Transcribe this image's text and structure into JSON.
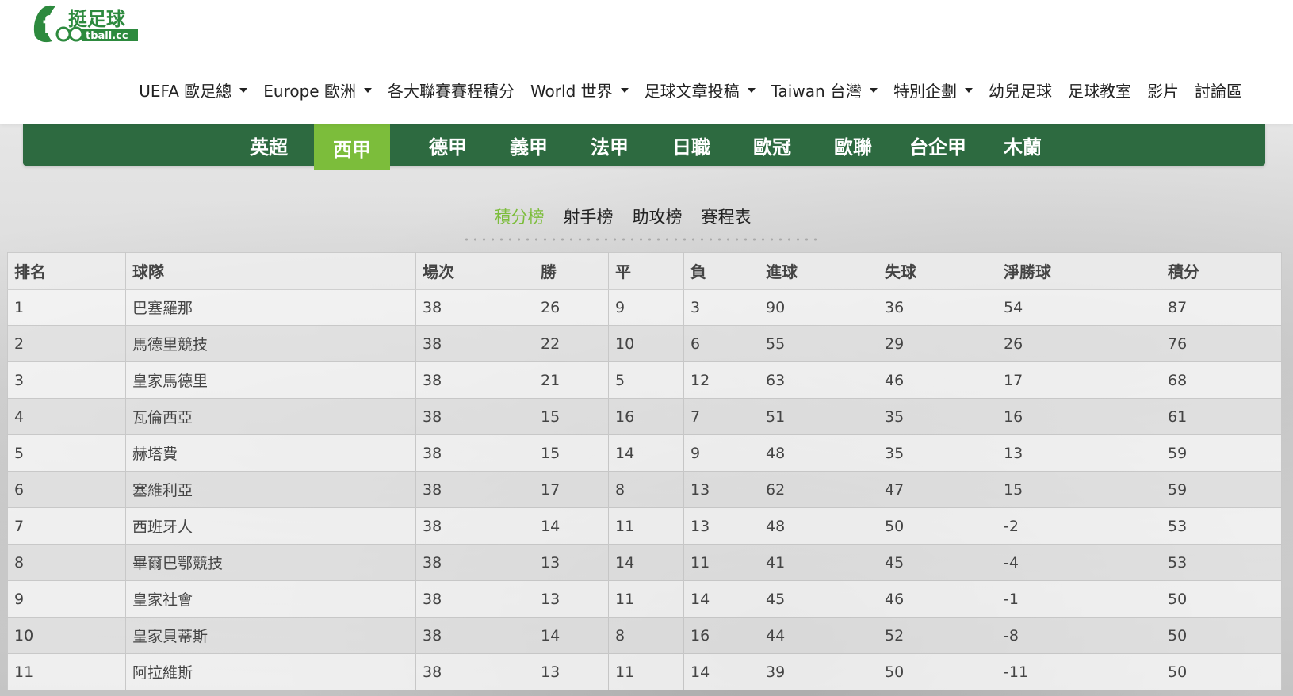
{
  "header": {
    "logo_text": "挺足球",
    "logo_sub": "football.cc",
    "brand_color": "#2d8a3e",
    "nav": [
      {
        "label": "UEFA 歐足總",
        "dropdown": true
      },
      {
        "label": "Europe 歐洲",
        "dropdown": true
      },
      {
        "label": "各大聯賽賽程積分",
        "dropdown": false
      },
      {
        "label": "World 世界",
        "dropdown": true
      },
      {
        "label": "足球文章投稿",
        "dropdown": true
      },
      {
        "label": "Taiwan 台灣",
        "dropdown": true
      },
      {
        "label": "特別企劃",
        "dropdown": true
      },
      {
        "label": "幼兒足球",
        "dropdown": false
      },
      {
        "label": "足球教室",
        "dropdown": false
      },
      {
        "label": "影片",
        "dropdown": false
      },
      {
        "label": "討論區",
        "dropdown": false
      }
    ]
  },
  "leagues": {
    "bar_color": "#2d6a40",
    "active_color": "#7cbd3b",
    "active_index": 1,
    "tabs": [
      "英超",
      "西甲",
      "德甲",
      "義甲",
      "法甲",
      "日職",
      "歐冠",
      "歐聯",
      "台企甲",
      "木蘭"
    ]
  },
  "subtabs": {
    "active_index": 0,
    "items": [
      "積分榜",
      "射手榜",
      "助攻榜",
      "賽程表"
    ]
  },
  "standings": {
    "columns": [
      "排名",
      "球隊",
      "場次",
      "勝",
      "平",
      "負",
      "進球",
      "失球",
      "淨勝球",
      "積分"
    ],
    "rows": [
      [
        "1",
        "巴塞羅那",
        "38",
        "26",
        "9",
        "3",
        "90",
        "36",
        "54",
        "87"
      ],
      [
        "2",
        "馬德里競技",
        "38",
        "22",
        "10",
        "6",
        "55",
        "29",
        "26",
        "76"
      ],
      [
        "3",
        "皇家馬德里",
        "38",
        "21",
        "5",
        "12",
        "63",
        "46",
        "17",
        "68"
      ],
      [
        "4",
        "瓦倫西亞",
        "38",
        "15",
        "16",
        "7",
        "51",
        "35",
        "16",
        "61"
      ],
      [
        "5",
        "赫塔費",
        "38",
        "15",
        "14",
        "9",
        "48",
        "35",
        "13",
        "59"
      ],
      [
        "6",
        "塞維利亞",
        "38",
        "17",
        "8",
        "13",
        "62",
        "47",
        "15",
        "59"
      ],
      [
        "7",
        "西班牙人",
        "38",
        "14",
        "11",
        "13",
        "48",
        "50",
        "-2",
        "53"
      ],
      [
        "8",
        "畢爾巴鄂競技",
        "38",
        "13",
        "14",
        "11",
        "41",
        "45",
        "-4",
        "53"
      ],
      [
        "9",
        "皇家社會",
        "38",
        "13",
        "11",
        "14",
        "45",
        "46",
        "-1",
        "50"
      ],
      [
        "10",
        "皇家貝蒂斯",
        "38",
        "14",
        "8",
        "16",
        "44",
        "52",
        "-8",
        "50"
      ],
      [
        "11",
        "阿拉維斯",
        "38",
        "13",
        "11",
        "14",
        "39",
        "50",
        "-11",
        "50"
      ]
    ]
  }
}
